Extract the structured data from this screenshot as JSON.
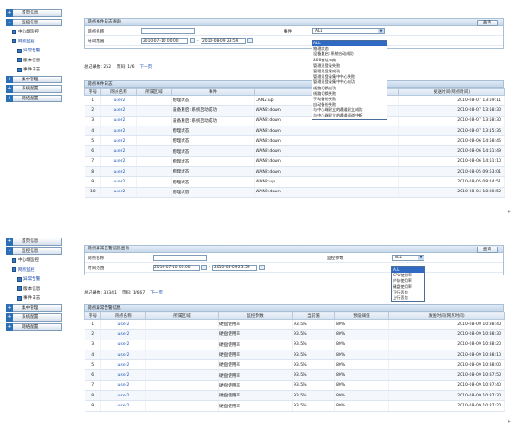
{
  "sidebar": {
    "items": [
      {
        "label": "首页信息",
        "level": "top",
        "toggle": "+"
      },
      {
        "label": "监控信息",
        "level": "top",
        "toggle": "-"
      },
      {
        "label": "中心端监控",
        "level": "sub"
      },
      {
        "label": "网点监控",
        "level": "sub"
      },
      {
        "label": "异常告警",
        "level": "sub2"
      },
      {
        "label": "版本信息",
        "level": "sub2"
      },
      {
        "label": "事件日志",
        "level": "sub2"
      },
      {
        "label": "集中管理",
        "level": "top",
        "toggle": "+"
      },
      {
        "label": "系统配置",
        "level": "top",
        "toggle": "+"
      },
      {
        "label": "网络配置",
        "level": "top",
        "toggle": "+"
      }
    ]
  },
  "top": {
    "title": "网点事件日志查询",
    "query_btn": "查询",
    "name_label": "网点名称",
    "event_label": "事件",
    "event_value": "ALL",
    "range_label": "时间范围",
    "date_from": "2010-07-10 00:00",
    "date_to": "2010-08-09 23:59",
    "range_sep": "-",
    "total": "总记录数: 252",
    "page": "页码: 1/6",
    "next": "下一页",
    "table_title": "网点事件日志",
    "headers": [
      "序号",
      "网点名称",
      "所属区域",
      "事件",
      "",
      "发送时间(网点时间)"
    ],
    "rows": [
      [
        "1",
        "user2",
        "",
        "物理状态",
        "LAN2:up",
        "2010-08-07 13:59:11"
      ],
      [
        "2",
        "user2",
        "",
        "设备重启: 系统启动成功",
        "WAN2:down",
        "2010-08-07 13:58:30"
      ],
      [
        "3",
        "user2",
        "",
        "设备重启: 系统启动成功",
        "WAN2:down",
        "2010-08-07 13:58:30"
      ],
      [
        "4",
        "user2",
        "",
        "物理状态",
        "WAN2:down",
        "2010-08-07 13:15:36"
      ],
      [
        "5",
        "user2",
        "",
        "物理状态",
        "WAN2:down",
        "2010-08-06 14:58:45"
      ],
      [
        "6",
        "user2",
        "",
        "物理状态",
        "WAN2:down",
        "2010-08-06 14:51:49"
      ],
      [
        "7",
        "user2",
        "",
        "物理状态",
        "WAN2:down",
        "2010-08-06 14:51:10"
      ],
      [
        "8",
        "user2",
        "",
        "物理状态",
        "WAN2:down",
        "2010-08-05 09:53:01"
      ],
      [
        "9",
        "user2",
        "",
        "物理状态",
        "WAN2:up",
        "2010-08-05 08:14:51"
      ],
      [
        "10",
        "user2",
        "",
        "物理状态",
        "WAN2:down",
        "2010-08-04 18:30:52"
      ]
    ],
    "dropdown": [
      "ALL",
      "物理状态",
      "设备重启: 系统启动成功",
      "ARP地址冲突",
      "管理员登录失败",
      "管理员登录成功",
      "管理员登录集中中心失败",
      "管理员登录集中中心成功",
      "线路切换成功",
      "线路切换失败",
      "手动备份失败",
      "自动备份失败",
      "与中心端建立的通道建立成功",
      "与中心端建立的通道通道中断"
    ]
  },
  "bottom": {
    "title": "网点异常告警信息查询",
    "query_btn": "查询",
    "name_label": "网点名称",
    "param_label": "监控参数",
    "param_value": "ALL",
    "range_label": "时间范围",
    "date_from": "2010-07-10 00:00",
    "date_to": "2010-08-09 23:59",
    "range_sep": "-",
    "total": "总记录数: 33341",
    "page": "页码: 1/667",
    "next": "下一页",
    "table_title": "网点异常告警信息",
    "headers": [
      "序号",
      "网点名称",
      "所属区域",
      "监控参数",
      "当前值",
      "预设阈值",
      "发送时间(网点时间)"
    ],
    "rows": [
      [
        "1",
        "user2",
        "",
        "硬盘使用率",
        "93.5%",
        "80%",
        "2010-08-09 10:38:40"
      ],
      [
        "2",
        "user2",
        "",
        "硬盘使用率",
        "93.5%",
        "80%",
        "2010-08-09 10:38:30"
      ],
      [
        "3",
        "user2",
        "",
        "硬盘使用率",
        "93.5%",
        "80%",
        "2010-08-09 10:38:20"
      ],
      [
        "4",
        "user2",
        "",
        "硬盘使用率",
        "93.5%",
        "80%",
        "2010-08-09 10:38:10"
      ],
      [
        "5",
        "user2",
        "",
        "硬盘使用率",
        "93.5%",
        "80%",
        "2010-08-09 10:38:00"
      ],
      [
        "6",
        "user2",
        "",
        "硬盘使用率",
        "93.5%",
        "80%",
        "2010-08-09 10:37:50"
      ],
      [
        "7",
        "user2",
        "",
        "硬盘使用率",
        "93.5%",
        "80%",
        "2010-08-09 10:37:40"
      ],
      [
        "8",
        "user2",
        "",
        "硬盘使用率",
        "93.5%",
        "80%",
        "2010-08-09 10:37:30"
      ],
      [
        "9",
        "user2",
        "",
        "硬盘使用率",
        "93.5%",
        "80%",
        "2010-08-09 10:37:20"
      ]
    ],
    "dropdown": [
      "ALL",
      "CPU使用率",
      "内存使用率",
      "硬盘使用率",
      "下行丢包",
      "上行丢包"
    ]
  },
  "marker": "+"
}
